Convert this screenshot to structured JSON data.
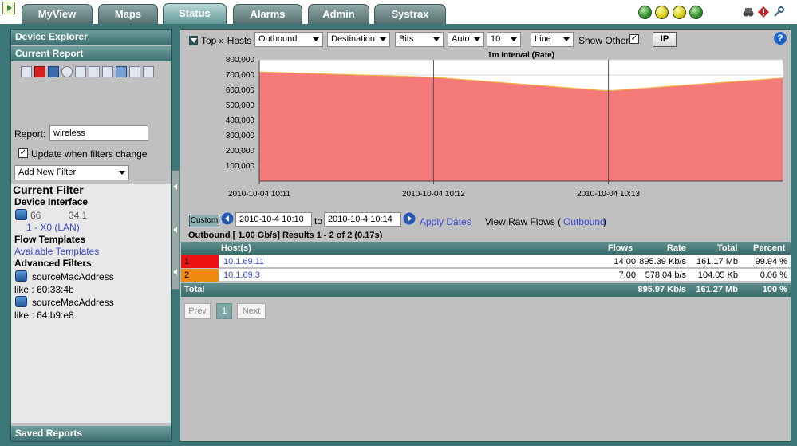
{
  "nav": {
    "tabs": [
      {
        "label": "MyView",
        "active": false
      },
      {
        "label": "Maps",
        "active": false
      },
      {
        "label": "Status",
        "active": true
      },
      {
        "label": "Alarms",
        "active": false
      },
      {
        "label": "Admin",
        "active": false
      },
      {
        "label": "Systrax",
        "active": false
      }
    ],
    "status_lights": [
      "green",
      "yellow",
      "yellow",
      "green"
    ],
    "toolbar_icons": [
      "binoculars-icon",
      "diamond-alert-icon",
      "tools-icon"
    ]
  },
  "sidebar": {
    "device_explorer": "Device Explorer",
    "current_report": "Current Report",
    "report_label": "Report:",
    "report_value": "wireless",
    "update_label": "Update when filters change",
    "update_checked": true,
    "add_filter": "Add New Filter",
    "current_filter_title": "Current Filter",
    "device_interface_label": "Device Interface",
    "device_ip_a": "66",
    "device_ip_b": "34.1",
    "device_interface_value": "1 - X0 (LAN)",
    "flow_templates_label": "Flow Templates",
    "available_templates": "Available Templates",
    "advanced_filters_label": "Advanced Filters",
    "filters": [
      {
        "name": "sourceMacAddress",
        "value": "like : 60:33:4b"
      },
      {
        "name": "sourceMacAddress",
        "value": "like : 64:b9:e8"
      }
    ],
    "saved_reports": "Saved Reports"
  },
  "controls": {
    "top_hosts": "Top » Hosts",
    "direction": "Outbound",
    "side": "Destination",
    "unit": "Bits",
    "scale": "Auto",
    "count": "10",
    "chart_type": "Line",
    "show_other": "Show Other",
    "show_other_checked": true,
    "ip_button": "IP",
    "custom_label": "Custom",
    "from_date": "2010-10-4 10:10",
    "to_label": "to",
    "to_date": "2010-10-4 10:14",
    "apply_dates": "Apply Dates",
    "view_raw": "View Raw Flows (",
    "raw_link": "Outbound",
    "view_raw_close": ")"
  },
  "chart_data": {
    "type": "area",
    "title": "1m Interval (Rate)",
    "x": [
      "2010-10-04 10:11",
      "2010-10-04 10:12",
      "2010-10-04 10:13",
      "2010-10-04 10:14"
    ],
    "x_labels": [
      "2010-10-04 10:11",
      "2010-10-04 10:12",
      "2010-10-04 10:13"
    ],
    "series": [
      {
        "values": [
          720000,
          685000,
          595000,
          680000
        ],
        "color": "#f47a7a"
      }
    ],
    "ylim": [
      0,
      800000
    ],
    "yticks": [
      "100,000",
      "200,000",
      "300,000",
      "400,000",
      "500,000",
      "600,000",
      "700,000",
      "800,000"
    ],
    "grid": true
  },
  "results": {
    "summary": "Outbound [ 1.00 Gb/s] Results 1 - 2 of 2 (0.17s)",
    "headers": [
      "Host(s)",
      "Flows",
      "Rate",
      "Total",
      "Percent"
    ],
    "rows": [
      {
        "rank": "1",
        "host": "10.1.69.11",
        "flows": "14.00",
        "rate": "895.39 Kb/s",
        "total": "161.17 Mb",
        "percent": "99.94 %",
        "color": "#ee1111"
      },
      {
        "rank": "2",
        "host": "10.1.69.3",
        "flows": "7.00",
        "rate": "578.04 b/s",
        "total": "104.05 Kb",
        "percent": "0.06 %",
        "color": "#f08a10"
      }
    ],
    "total_label": "Total",
    "total_rate": "895.97 Kb/s",
    "total_total": "161.27 Mb",
    "total_percent": "100 %"
  },
  "pager": {
    "prev": "Prev",
    "page": "1",
    "next": "Next"
  }
}
